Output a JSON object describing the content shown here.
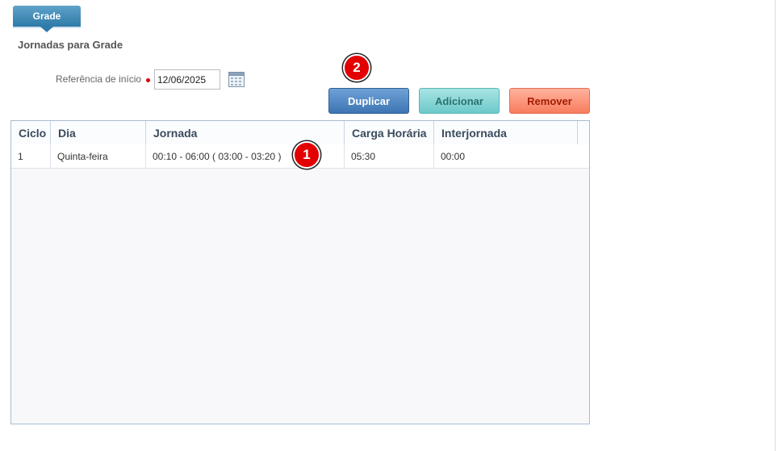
{
  "tab": {
    "label": "Grade"
  },
  "section": {
    "title": "Jornadas para Grade"
  },
  "reference": {
    "label": "Referência de início",
    "value": "12/06/2025"
  },
  "icons": {
    "calendar": "calendar-icon"
  },
  "buttons": {
    "duplicate": "Duplicar",
    "add": "Adicionar",
    "remove": "Remover"
  },
  "colors": {
    "tab": "#2f7aa8",
    "duplicate": "#3e74b3",
    "add": "#6cc9c9",
    "remove": "#f87c5e",
    "badge": "#e30000"
  },
  "annotations": {
    "badge1": "1",
    "badge2": "2"
  },
  "table": {
    "headers": [
      "Ciclo",
      "Dia",
      "Jornada",
      "Carga Horária",
      "Interjornada"
    ],
    "rows": [
      {
        "ciclo": "1",
        "dia": "Quinta-feira",
        "jornada": "00:10 - 06:00 ( 03:00 - 03:20 )",
        "carga": "05:30",
        "interjornada": "00:00"
      }
    ]
  }
}
